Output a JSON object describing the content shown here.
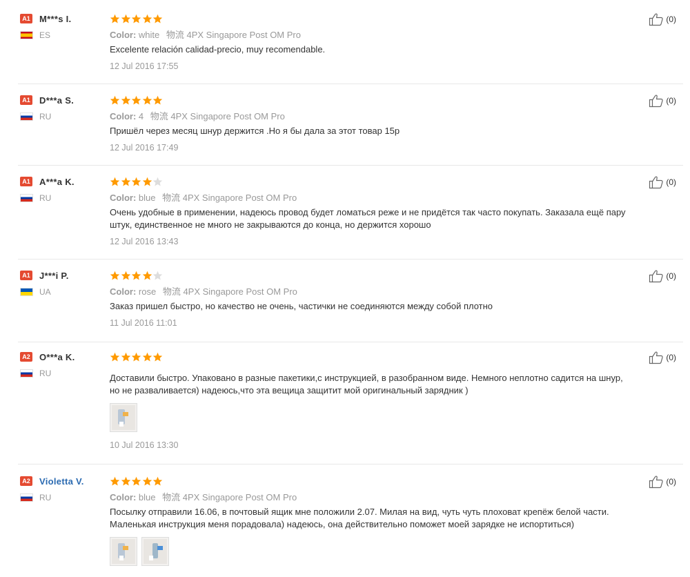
{
  "feedback": {
    "reviews": [
      {
        "level": "A1",
        "name": "M***s I.",
        "name_link": false,
        "country_code": "ES",
        "flag": "es",
        "stars": 5,
        "color_label": "Color:",
        "color_value": "white",
        "shipping": "物流 4PX Singapore Post OM Pro",
        "text": "Excelente relación calidad-precio, muy recomendable.",
        "text2": "",
        "photos": 0,
        "date": "12 Jul 2016 17:55",
        "likes": "(0)"
      },
      {
        "level": "A1",
        "name": "D***a S.",
        "name_link": false,
        "country_code": "RU",
        "flag": "ru",
        "stars": 5,
        "color_label": "Color:",
        "color_value": "4",
        "shipping": "物流 4PX Singapore Post OM Pro",
        "text": "Пришёл через месяц шнур держится .Но я бы дала за этот товар 15р",
        "text2": "",
        "photos": 0,
        "date": "12 Jul 2016 17:49",
        "likes": "(0)"
      },
      {
        "level": "A1",
        "name": "A***a K.",
        "name_link": false,
        "country_code": "RU",
        "flag": "ru",
        "stars": 4,
        "color_label": "Color:",
        "color_value": "blue",
        "shipping": "物流 4PX Singapore Post OM Pro",
        "text": "Очень удобные в применении, надеюсь провод будет ломаться реже и не придётся так часто покупать. Заказала ещё пару",
        "text2": "штук, единственное не много не закрываются до конца, но держится хорошо",
        "photos": 0,
        "date": "12 Jul 2016 13:43",
        "likes": "(0)"
      },
      {
        "level": "A1",
        "name": "J***i P.",
        "name_link": false,
        "country_code": "UA",
        "flag": "ua",
        "stars": 4,
        "color_label": "Color:",
        "color_value": "rose",
        "shipping": "物流 4PX Singapore Post OM Pro",
        "text": "Заказ пришел быстро, но качество не очень, частички не соединяются между собой плотно",
        "text2": "",
        "photos": 0,
        "date": "11 Jul 2016 11:01",
        "likes": "(0)"
      },
      {
        "level": "A2",
        "name": "O***a K.",
        "name_link": false,
        "country_code": "RU",
        "flag": "ru",
        "stars": 5,
        "color_label": "",
        "color_value": "",
        "shipping": "",
        "text": "Доставили быстро. Упаковано в разные пакетики,с инструкцией, в разобранном виде. Немного неплотно садится на шнур,",
        "text2": "но не разваливается) надеюсь,что эта вещица защитит мой оригинальный зарядник )",
        "photos": 1,
        "date": "10 Jul 2016 13:30",
        "likes": "(0)"
      },
      {
        "level": "A2",
        "name": "Violetta V.",
        "name_link": true,
        "country_code": "RU",
        "flag": "ru",
        "stars": 5,
        "color_label": "Color:",
        "color_value": "blue",
        "shipping": "物流 4PX Singapore Post OM Pro",
        "text": "Посылку отправили 16.06, в почтовый ящик мне положили 2.07. Милая на вид, чуть чуть плоховат крепёж белой части.",
        "text2": "Маленькая инструкция меня порадовала) надеюсь, она действительно поможет моей зарядке не испортиться)",
        "photos": 2,
        "date": "",
        "likes": "(0)"
      }
    ],
    "colors": {
      "level_badge": "#e44a31",
      "star_fill": "#ff9a00",
      "star_empty": "#dddddd",
      "link": "#2a6ab1"
    },
    "icons": {
      "like": "thumbs-up-icon",
      "star": "star-icon"
    }
  }
}
